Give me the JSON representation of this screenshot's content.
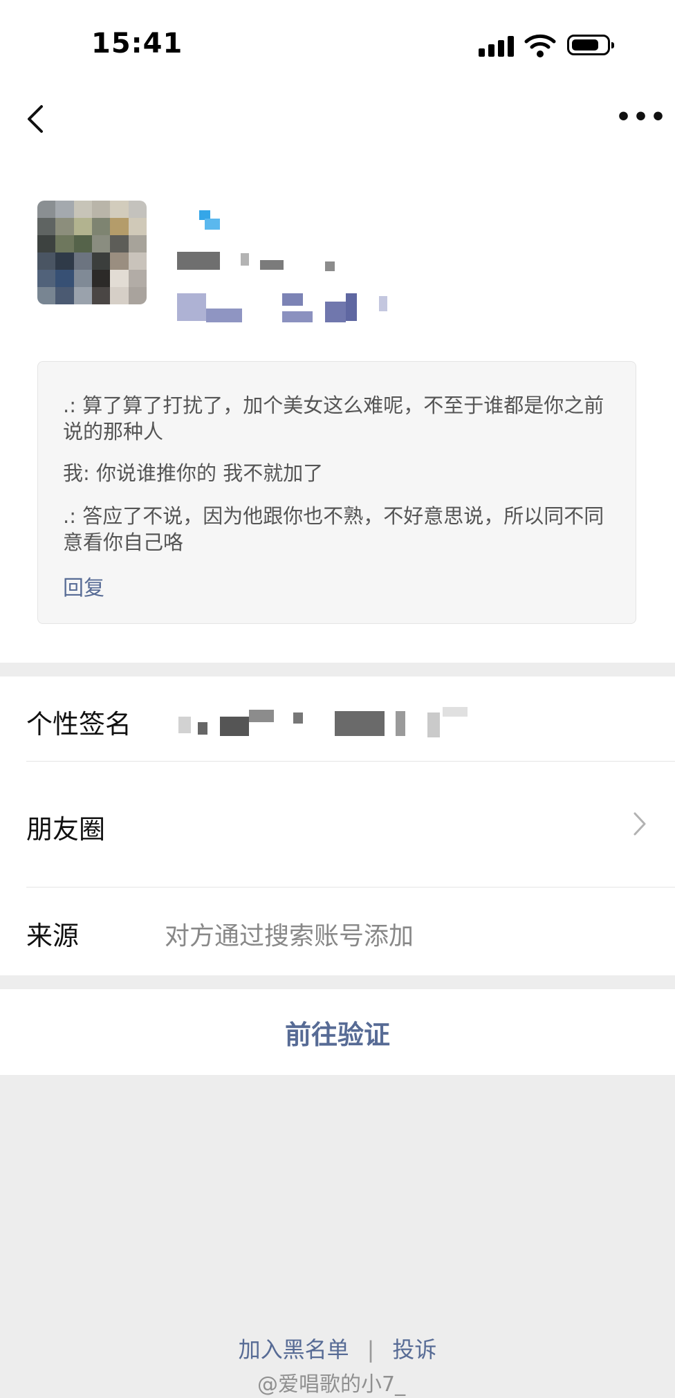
{
  "status_bar": {
    "time": "15:41"
  },
  "messages": [
    ".: 算了算了打扰了，加个美女这么难呢，不至于谁都是你之前说的那种人",
    "我: 你说谁推你的 我不就加了",
    ".: 答应了不说，因为他跟你也不熟，不好意思说，所以同不同意看你自己咯"
  ],
  "reply_label": "回复",
  "rows": {
    "signature_label": "个性签名",
    "moments_label": "朋友圈",
    "source_label": "来源",
    "source_value": "对方通过搜索账号添加"
  },
  "verify_label": "前往验证",
  "footer": {
    "blacklist": "加入黑名单",
    "separator": "|",
    "report": "投诉"
  },
  "watermark": "@爱唱歌的小7_",
  "colors": {
    "link": "#576b95",
    "background": "#ededed",
    "card": "#f6f6f6"
  }
}
